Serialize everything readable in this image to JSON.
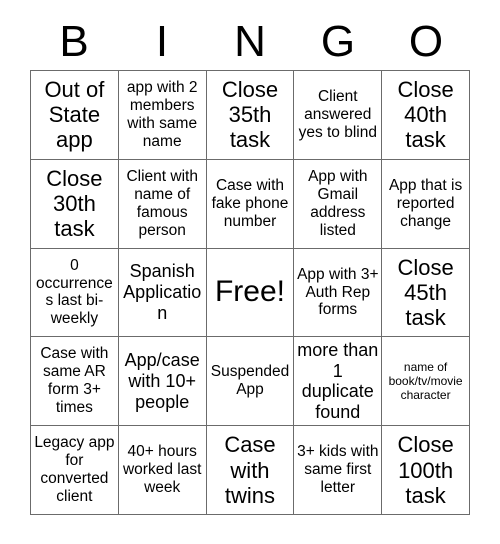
{
  "card": {
    "title": "BINGO",
    "header_letters": [
      "B",
      "I",
      "N",
      "G",
      "O"
    ],
    "columns": 5,
    "rows": 5,
    "border_color": "#6b6b6b",
    "background_color": "#ffffff",
    "text_color": "#000000",
    "free_space": {
      "row": 3,
      "column": 3,
      "label": "Free!"
    },
    "cells": [
      {
        "id": "b1",
        "text": "Out of State app",
        "size": "lg"
      },
      {
        "id": "i1",
        "text": "app with 2 members with same name",
        "size": "sm"
      },
      {
        "id": "n1",
        "text": "Close 35th task",
        "size": "lg"
      },
      {
        "id": "g1",
        "text": "Client answered yes to blind",
        "size": "sm"
      },
      {
        "id": "o1",
        "text": "Close 40th task",
        "size": "lg"
      },
      {
        "id": "b2",
        "text": "Close 30th task",
        "size": "lg"
      },
      {
        "id": "i2",
        "text": "Client with name of famous person",
        "size": "sm"
      },
      {
        "id": "n2",
        "text": "Case with fake phone number",
        "size": "sm"
      },
      {
        "id": "g2",
        "text": "App with Gmail address listed",
        "size": "sm"
      },
      {
        "id": "o2",
        "text": "App that is reported change",
        "size": "sm"
      },
      {
        "id": "b3",
        "text": "0 occurrences last bi-weekly",
        "size": "sm"
      },
      {
        "id": "i3",
        "text": "Spanish Application",
        "size": "md"
      },
      {
        "id": "n3",
        "text": "Free!",
        "size": "xl"
      },
      {
        "id": "g3",
        "text": "App with 3+ Auth Rep forms",
        "size": "sm"
      },
      {
        "id": "o3",
        "text": "Close 45th task",
        "size": "lg"
      },
      {
        "id": "b4",
        "text": "Case with same AR form 3+ times",
        "size": "sm"
      },
      {
        "id": "i4",
        "text": "App/case with 10+ people",
        "size": "md"
      },
      {
        "id": "n4",
        "text": "Suspended App",
        "size": "sm"
      },
      {
        "id": "g4",
        "text": "more than 1 duplicate found",
        "size": "md"
      },
      {
        "id": "o4",
        "text": "name of book/tv/movie character",
        "size": "xs"
      },
      {
        "id": "b5",
        "text": "Legacy app for converted client",
        "size": "sm"
      },
      {
        "id": "i5",
        "text": "40+ hours worked last week",
        "size": "sm"
      },
      {
        "id": "n5",
        "text": "Case with twins",
        "size": "lg"
      },
      {
        "id": "g5",
        "text": "3+ kids with same first letter",
        "size": "sm"
      },
      {
        "id": "o5",
        "text": "Close 100th task",
        "size": "lg"
      }
    ]
  }
}
